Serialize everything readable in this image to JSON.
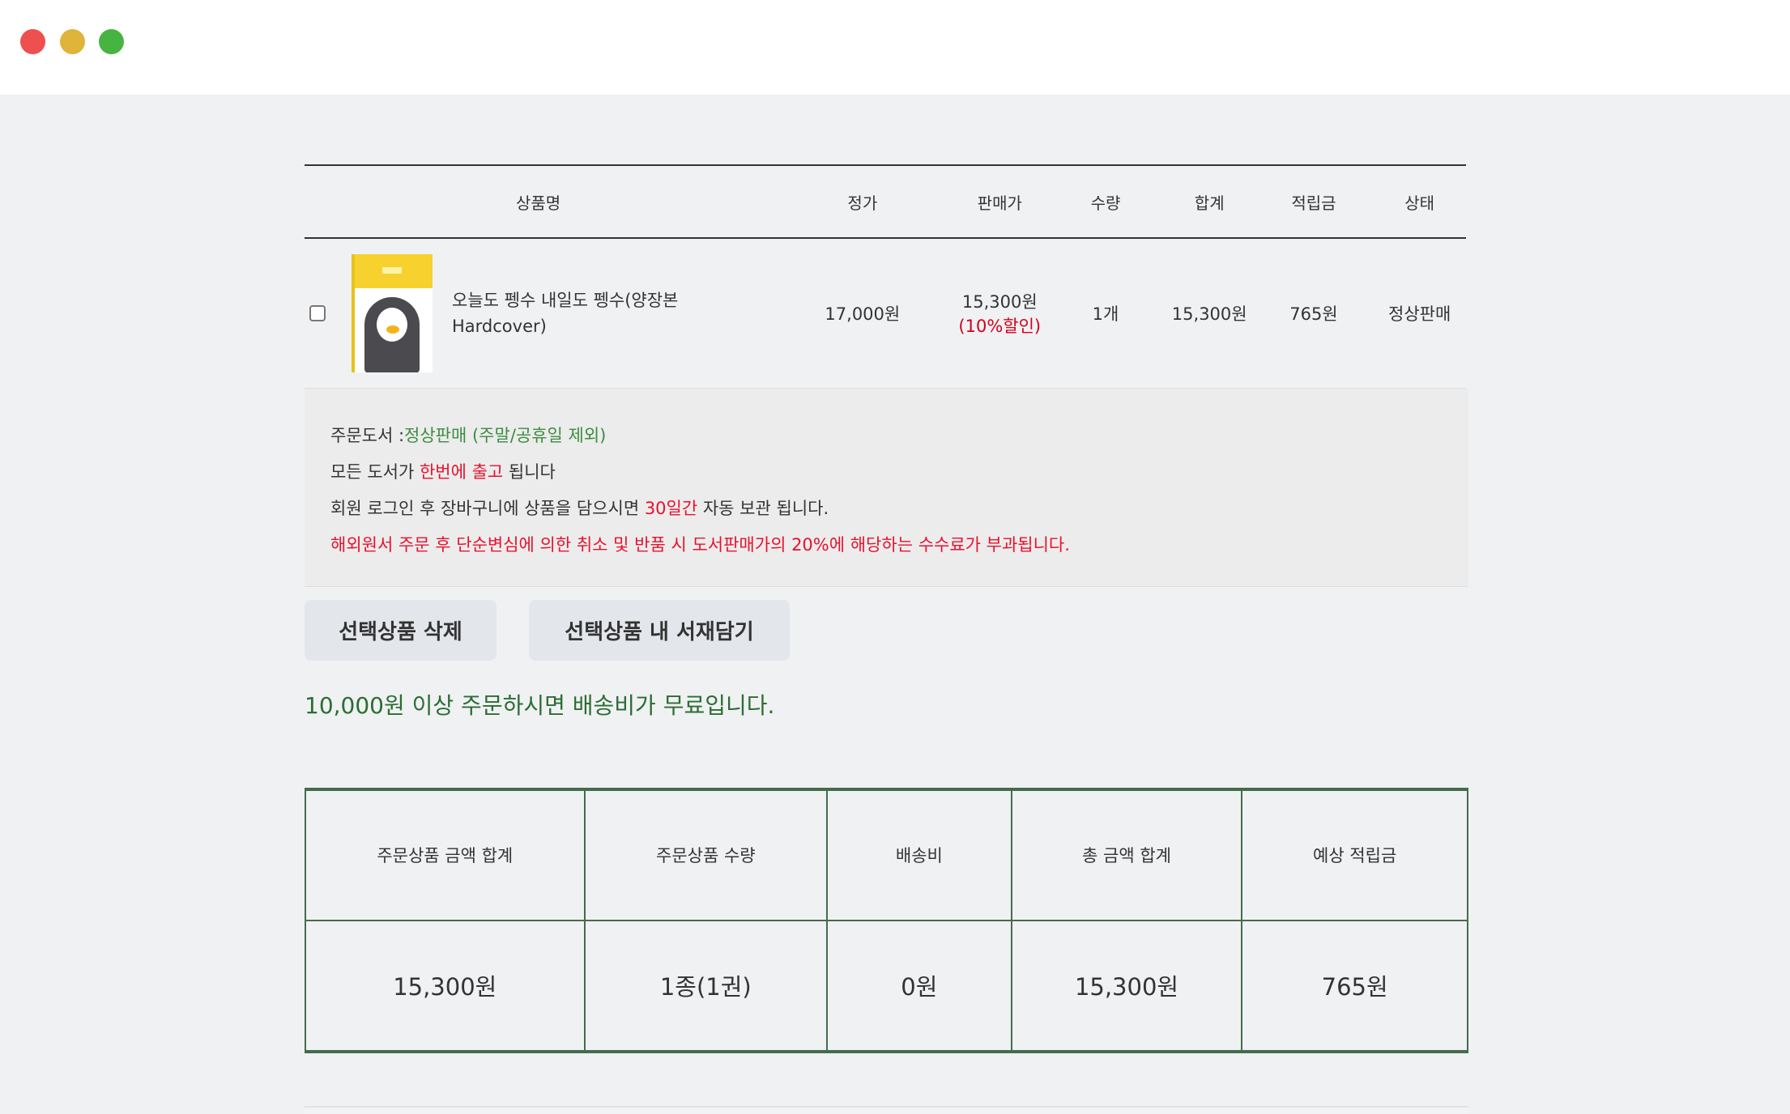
{
  "window": {
    "controls": [
      "close",
      "minimize",
      "maximize"
    ]
  },
  "cart": {
    "columns": [
      "상품명",
      "정가",
      "판매가",
      "수량",
      "합계",
      "적립금",
      "상태"
    ],
    "items": [
      {
        "title_line1": "오늘도 펭수 내일도 펭수(양장본",
        "title_line2": "Hardcover)",
        "list_price": "17,000원",
        "sale_price": "15,300원",
        "discount": "(10%할인)",
        "quantity": "1개",
        "total": "15,300원",
        "points": "765원",
        "status": "정상판매"
      }
    ]
  },
  "info": {
    "line1_label": "주문도서 :",
    "line1_value": "정상판매 (주말/공휴일 제외)",
    "line2_pre": "모든 도서가 ",
    "line2_highlight": "한번에 출고",
    "line2_post": "  됩니다",
    "line3_pre": "회원 로그인 후 장바구니에 상품을 담으시면 ",
    "line3_highlight": "30일간",
    "line3_post": "  자동 보관 됩니다.",
    "line4": "해외원서 주문 후 단순변심에 의한 취소 및 반품 시 도서판매가의 20%에 해당하는 수수료가 부과됩니다."
  },
  "buttons": {
    "delete_selected": "선택상품 삭제",
    "add_to_shelf": "선택상품 내 서재담기"
  },
  "free_shipping_notice": "10,000원 이상 주문하시면 배송비가 무료입니다.",
  "summary": {
    "headers": [
      "주문상품 금액 합계",
      "주문상품 수량",
      "배송비",
      "총 금액 합계",
      "예상 적립금"
    ],
    "values": [
      "15,300원",
      "1종(1권)",
      "0원",
      "15,300원",
      "765원"
    ]
  },
  "colors": {
    "accent_red": "#d0021b",
    "green": "#3d8c40",
    "border_green": "#456b4d"
  }
}
